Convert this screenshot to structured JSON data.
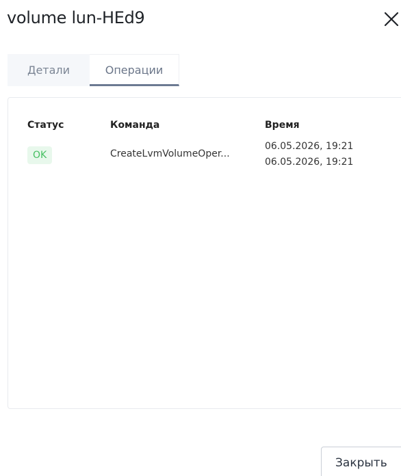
{
  "dialog": {
    "title": "volume lun-HEd9",
    "close_icon": "close-icon"
  },
  "tabs": [
    {
      "label": "Детали",
      "active": false
    },
    {
      "label": "Операции",
      "active": true
    }
  ],
  "table": {
    "headers": [
      "Статус",
      "Команда",
      "Время"
    ],
    "rows": [
      {
        "status": "OK",
        "command": "CreateLvmVolumeOper...",
        "time_start": "06.05.2026, 19:21",
        "time_end": "06.05.2026, 19:21"
      }
    ]
  },
  "footer": {
    "close_label": "Закрыть"
  },
  "colors": {
    "status_ok_text": "#46c062",
    "status_ok_bg": "#e8f8ec",
    "tab_active_underline": "#6c7a92"
  }
}
